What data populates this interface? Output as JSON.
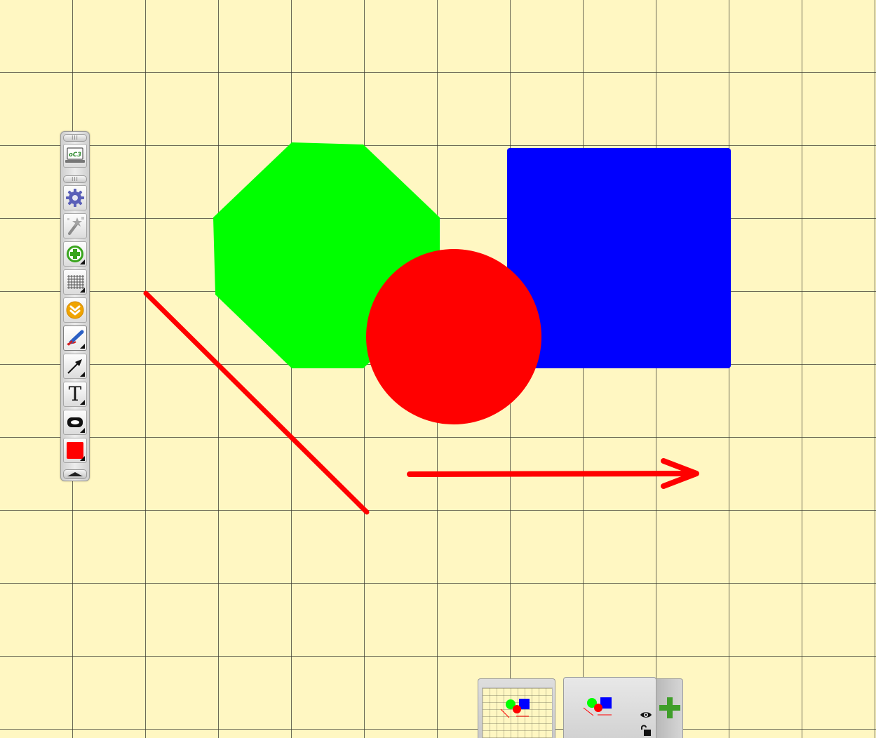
{
  "app": {
    "logo_text": "oC3",
    "background_color": "#fff7c2",
    "grid_color": "#3c3c32"
  },
  "toolbar": {
    "tools": [
      {
        "name": "settings",
        "icon": "gear-icon",
        "color": "#5a5fb8"
      },
      {
        "name": "select",
        "icon": "magic-wand-icon",
        "color": "#8c8c8c"
      },
      {
        "name": "add",
        "icon": "plus-circle-icon",
        "color": "#39a51d"
      },
      {
        "name": "grid",
        "icon": "grid-icon",
        "color": "#555555"
      },
      {
        "name": "scroll",
        "icon": "double-chevron-down-icon",
        "color": "#f0a400"
      },
      {
        "name": "pen",
        "icon": "pen-icon",
        "color": "#d32020"
      },
      {
        "name": "line",
        "icon": "arrow-line-icon",
        "color": "#111111"
      },
      {
        "name": "text",
        "icon": "text-icon",
        "label": "T",
        "color": "#111111"
      },
      {
        "name": "shape",
        "icon": "rounded-shape-icon",
        "color": "#111111"
      },
      {
        "name": "color",
        "icon": "color-swatch-icon",
        "color": "#ff0000"
      }
    ]
  },
  "drawing": {
    "octagon_color": "#00ff00",
    "square_color": "#0000ff",
    "circle_color": "#ff0000",
    "stroke_color": "#ff0000"
  },
  "pages": {
    "page_2": {
      "visibility_icon": "eye-icon",
      "lock_icon": "unlock-icon"
    },
    "add_page_icon": "plus-icon",
    "add_page_color": "#3f9e2a"
  }
}
